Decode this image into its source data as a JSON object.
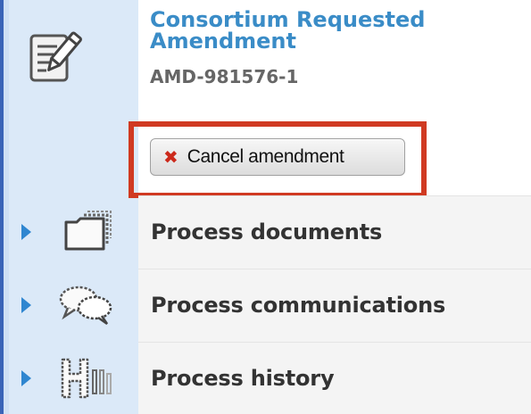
{
  "header": {
    "title": "Consortium Requested Amendment",
    "reference": "AMD-981576-1",
    "cancel_button": {
      "label": "Cancel amendment",
      "icon": "x-icon",
      "highlighted": true
    }
  },
  "sections": [
    {
      "label": "Process documents",
      "icon": "folder-icon",
      "expanded": false
    },
    {
      "label": "Process communications",
      "icon": "speech-bubbles-icon",
      "expanded": false
    },
    {
      "label": "Process history",
      "icon": "history-icon",
      "expanded": false
    }
  ],
  "colors": {
    "title": "#3a8cc7",
    "caret": "#2f86d0",
    "highlight": "#d03a22",
    "icon_column": "#dbe9f8"
  }
}
